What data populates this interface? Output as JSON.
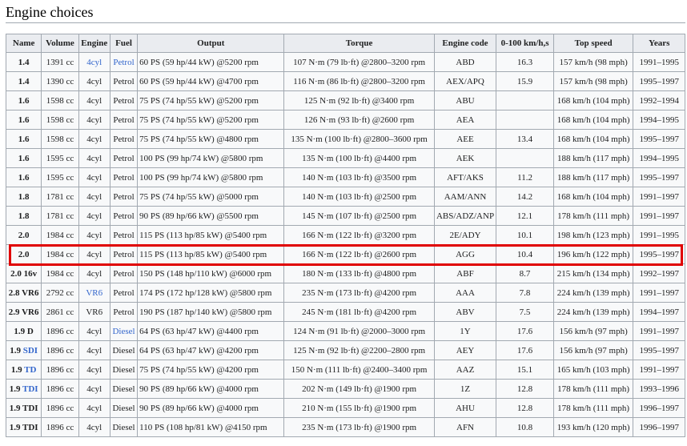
{
  "section": {
    "title": "Engine choices"
  },
  "table": {
    "headers": [
      "Name",
      "Volume",
      "Engine",
      "Fuel",
      "Output",
      "Torque",
      "Engine code",
      "0-100 km/h,s",
      "Top speed",
      "Years"
    ],
    "rows": [
      {
        "name_pre": "1.4",
        "name_link": "",
        "volume": "1391 cc",
        "engine": "4cyl",
        "engine_link": true,
        "fuel": "Petrol",
        "fuel_link": true,
        "output": "60 PS (59 hp/44 kW) @5200 rpm",
        "torque": "107 N·m (79 lb·ft) @2800–3200 rpm",
        "code": "ABD",
        "accel": "16.3",
        "top": "157 km/h (98 mph)",
        "years": "1991–1995"
      },
      {
        "name_pre": "1.4",
        "name_link": "",
        "volume": "1390 cc",
        "engine": "4cyl",
        "engine_link": false,
        "fuel": "Petrol",
        "fuel_link": false,
        "output": "60 PS (59 hp/44 kW) @4700 rpm",
        "torque": "116 N·m (86 lb·ft) @2800–3200 rpm",
        "code": "AEX/APQ",
        "accel": "15.9",
        "top": "157 km/h (98 mph)",
        "years": "1995–1997"
      },
      {
        "name_pre": "1.6",
        "name_link": "",
        "volume": "1598 cc",
        "engine": "4cyl",
        "engine_link": false,
        "fuel": "Petrol",
        "fuel_link": false,
        "output": "75 PS (74 hp/55 kW) @5200 rpm",
        "torque": "125 N·m (92 lb·ft) @3400 rpm",
        "code": "ABU",
        "accel": "",
        "top": "168 km/h (104 mph)",
        "years": "1992–1994"
      },
      {
        "name_pre": "1.6",
        "name_link": "",
        "volume": "1598 cc",
        "engine": "4cyl",
        "engine_link": false,
        "fuel": "Petrol",
        "fuel_link": false,
        "output": "75 PS (74 hp/55 kW) @5200 rpm",
        "torque": "126 N·m (93 lb·ft) @2600 rpm",
        "code": "AEA",
        "accel": "",
        "top": "168 km/h (104 mph)",
        "years": "1994–1995"
      },
      {
        "name_pre": "1.6",
        "name_link": "",
        "volume": "1598 cc",
        "engine": "4cyl",
        "engine_link": false,
        "fuel": "Petrol",
        "fuel_link": false,
        "output": "75 PS (74 hp/55 kW) @4800 rpm",
        "torque": "135 N·m (100 lb·ft) @2800–3600 rpm",
        "code": "AEE",
        "accel": "13.4",
        "top": "168 km/h (104 mph)",
        "years": "1995–1997"
      },
      {
        "name_pre": "1.6",
        "name_link": "",
        "volume": "1595 cc",
        "engine": "4cyl",
        "engine_link": false,
        "fuel": "Petrol",
        "fuel_link": false,
        "output": "100 PS (99 hp/74 kW) @5800 rpm",
        "torque": "135 N·m (100 lb·ft) @4400 rpm",
        "code": "AEK",
        "accel": "",
        "top": "188 km/h (117 mph)",
        "years": "1994–1995"
      },
      {
        "name_pre": "1.6",
        "name_link": "",
        "volume": "1595 cc",
        "engine": "4cyl",
        "engine_link": false,
        "fuel": "Petrol",
        "fuel_link": false,
        "output": "100 PS (99 hp/74 kW) @5800 rpm",
        "torque": "140 N·m (103 lb·ft) @3500 rpm",
        "code": "AFT/AKS",
        "accel": "11.2",
        "top": "188 km/h (117 mph)",
        "years": "1995–1997"
      },
      {
        "name_pre": "1.8",
        "name_link": "",
        "volume": "1781 cc",
        "engine": "4cyl",
        "engine_link": false,
        "fuel": "Petrol",
        "fuel_link": false,
        "output": "75 PS (74 hp/55 kW) @5000 rpm",
        "torque": "140 N·m (103 lb·ft) @2500 rpm",
        "code": "AAM/ANN",
        "accel": "14.2",
        "top": "168 km/h (104 mph)",
        "years": "1991–1997"
      },
      {
        "name_pre": "1.8",
        "name_link": "",
        "volume": "1781 cc",
        "engine": "4cyl",
        "engine_link": false,
        "fuel": "Petrol",
        "fuel_link": false,
        "output": "90 PS (89 hp/66 kW) @5500 rpm",
        "torque": "145 N·m (107 lb·ft) @2500 rpm",
        "code": "ABS/ADZ/ANP",
        "accel": "12.1",
        "top": "178 km/h (111 mph)",
        "years": "1991–1997"
      },
      {
        "name_pre": "2.0",
        "name_link": "",
        "volume": "1984 cc",
        "engine": "4cyl",
        "engine_link": false,
        "fuel": "Petrol",
        "fuel_link": false,
        "output": "115 PS (113 hp/85 kW) @5400 rpm",
        "torque": "166 N·m (122 lb·ft) @3200 rpm",
        "code": "2E/ADY",
        "accel": "10.1",
        "top": "198 km/h (123 mph)",
        "years": "1991–1995"
      },
      {
        "name_pre": "2.0",
        "name_link": "",
        "volume": "1984 cc",
        "engine": "4cyl",
        "engine_link": false,
        "fuel": "Petrol",
        "fuel_link": false,
        "output": "115 PS (113 hp/85 kW) @5400 rpm",
        "torque": "166 N·m (122 lb·ft) @2600 rpm",
        "code": "AGG",
        "accel": "10.4",
        "top": "196 km/h (122 mph)",
        "years": "1995–1997"
      },
      {
        "name_pre": "2.0 16v",
        "name_link": "",
        "volume": "1984 cc",
        "engine": "4cyl",
        "engine_link": false,
        "fuel": "Petrol",
        "fuel_link": false,
        "output": "150 PS (148 hp/110 kW) @6000 rpm",
        "torque": "180 N·m (133 lb·ft) @4800 rpm",
        "code": "ABF",
        "accel": "8.7",
        "top": "215 km/h (134 mph)",
        "years": "1992–1997"
      },
      {
        "name_pre": "2.8 VR6",
        "name_link": "",
        "volume": "2792 cc",
        "engine": "VR6",
        "engine_link": true,
        "fuel": "Petrol",
        "fuel_link": false,
        "output": "174 PS (172 hp/128 kW) @5800 rpm",
        "torque": "235 N·m (173 lb·ft) @4200 rpm",
        "code": "AAA",
        "accel": "7.8",
        "top": "224 km/h (139 mph)",
        "years": "1991–1997"
      },
      {
        "name_pre": "2.9 VR6",
        "name_link": "",
        "volume": "2861 cc",
        "engine": "VR6",
        "engine_link": false,
        "fuel": "Petrol",
        "fuel_link": false,
        "output": "190 PS (187 hp/140 kW) @5800 rpm",
        "torque": "245 N·m (181 lb·ft) @4200 rpm",
        "code": "ABV",
        "accel": "7.5",
        "top": "224 km/h (139 mph)",
        "years": "1994–1997"
      },
      {
        "name_pre": "1.9 D",
        "name_link": "",
        "volume": "1896 cc",
        "engine": "4cyl",
        "engine_link": false,
        "fuel": "Diesel",
        "fuel_link": true,
        "output": "64 PS (63 hp/47 kW) @4400 rpm",
        "torque": "124 N·m (91 lb·ft) @2000–3000 rpm",
        "code": "1Y",
        "accel": "17.6",
        "top": "156 km/h (97 mph)",
        "years": "1991–1997"
      },
      {
        "name_pre": "1.9 ",
        "name_link": "SDI",
        "volume": "1896 cc",
        "engine": "4cyl",
        "engine_link": false,
        "fuel": "Diesel",
        "fuel_link": false,
        "output": "64 PS (63 hp/47 kW) @4200 rpm",
        "torque": "125 N·m (92 lb·ft) @2200–2800 rpm",
        "code": "AEY",
        "accel": "17.6",
        "top": "156 km/h (97 mph)",
        "years": "1995–1997"
      },
      {
        "name_pre": "1.9 ",
        "name_link": "TD",
        "volume": "1896 cc",
        "engine": "4cyl",
        "engine_link": false,
        "fuel": "Diesel",
        "fuel_link": false,
        "output": "75 PS (74 hp/55 kW) @4200 rpm",
        "torque": "150 N·m (111 lb·ft) @2400–3400 rpm",
        "code": "AAZ",
        "accel": "15.1",
        "top": "165 km/h (103 mph)",
        "years": "1991–1997"
      },
      {
        "name_pre": "1.9 ",
        "name_link": "TDI",
        "volume": "1896 cc",
        "engine": "4cyl",
        "engine_link": false,
        "fuel": "Diesel",
        "fuel_link": false,
        "output": "90 PS (89 hp/66 kW) @4000 rpm",
        "torque": "202 N·m (149 lb·ft) @1900 rpm",
        "code": "1Z",
        "accel": "12.8",
        "top": "178 km/h (111 mph)",
        "years": "1993–1996"
      },
      {
        "name_pre": "1.9 TDI",
        "name_link": "",
        "volume": "1896 cc",
        "engine": "4cyl",
        "engine_link": false,
        "fuel": "Diesel",
        "fuel_link": false,
        "output": "90 PS (89 hp/66 kW) @4000 rpm",
        "torque": "210 N·m (155 lb·ft) @1900 rpm",
        "code": "AHU",
        "accel": "12.8",
        "top": "178 km/h (111 mph)",
        "years": "1996–1997"
      },
      {
        "name_pre": "1.9 TDI",
        "name_link": "",
        "volume": "1896 cc",
        "engine": "4cyl",
        "engine_link": false,
        "fuel": "Diesel",
        "fuel_link": false,
        "output": "110 PS (108 hp/81 kW) @4150 rpm",
        "torque": "235 N·m (173 lb·ft) @1900 rpm",
        "code": "AFN",
        "accel": "10.8",
        "top": "193 km/h (120 mph)",
        "years": "1996–1997"
      }
    ]
  },
  "highlight": {
    "row_index": 10,
    "color": "#e00000"
  },
  "colors": {
    "link": "#3366cc",
    "header_bg": "#eaecf0",
    "cell_bg": "#f8f9fa",
    "border": "#a2a9b1"
  }
}
